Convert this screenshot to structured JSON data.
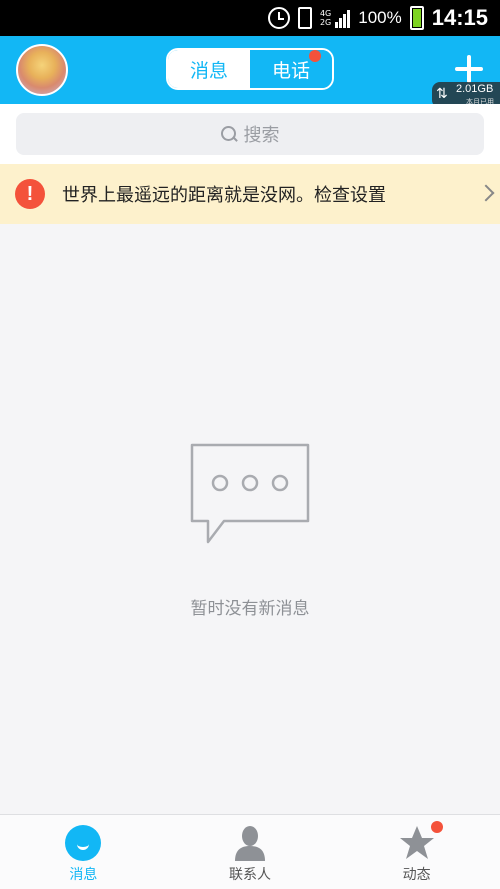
{
  "status_bar": {
    "network_top": "4G",
    "network_bottom": "2G",
    "battery_pct": "100%",
    "time": "14:15",
    "icons": [
      "alarm-icon",
      "vibrate-icon",
      "signal-icon",
      "battery-icon"
    ]
  },
  "header": {
    "tabs": [
      {
        "label": "消息",
        "active": true
      },
      {
        "label": "电话",
        "active": false,
        "badge": true
      }
    ],
    "data_usage": {
      "value": "2.01GB",
      "caption": "本月已用"
    }
  },
  "search": {
    "placeholder": "搜索"
  },
  "banner": {
    "text": "世界上最遥远的距离就是没网。检查设置"
  },
  "empty_state": {
    "text": "暂时没有新消息"
  },
  "bottom_nav": {
    "items": [
      {
        "label": "消息",
        "icon": "message-icon",
        "active": true
      },
      {
        "label": "联系人",
        "icon": "contacts-icon",
        "active": false
      },
      {
        "label": "动态",
        "icon": "star-icon",
        "active": false,
        "badge": true
      }
    ]
  },
  "colors": {
    "accent": "#12b7f5",
    "badge": "#f4523b",
    "banner_bg": "#fdf1cc",
    "background": "#f5f5f7"
  }
}
